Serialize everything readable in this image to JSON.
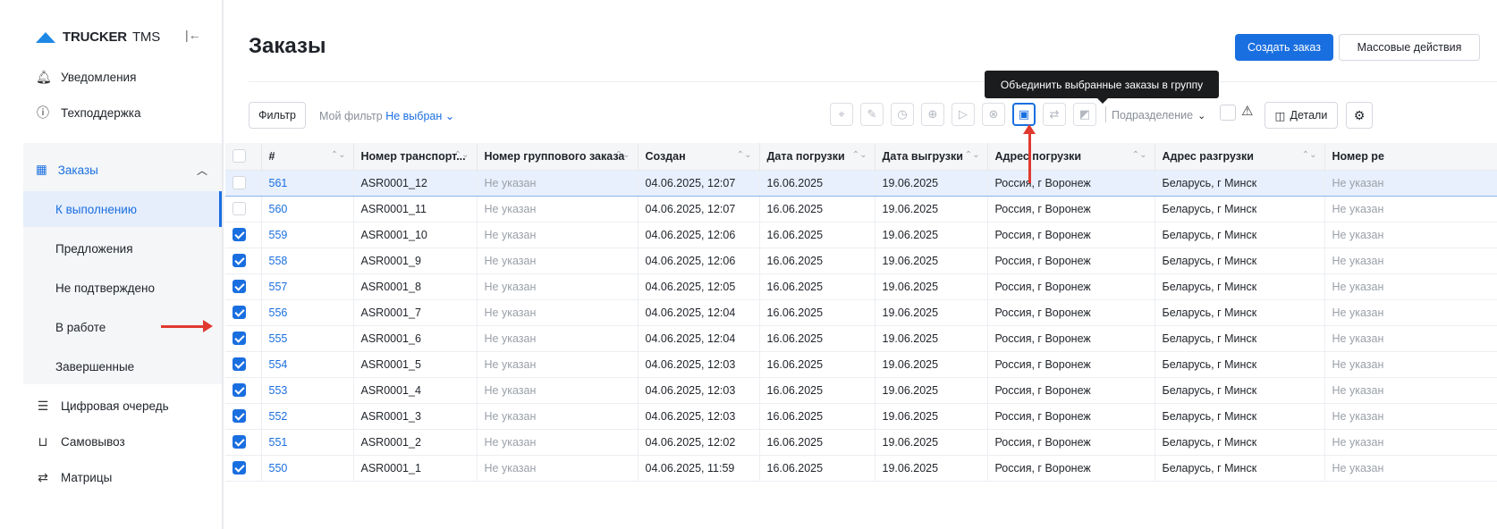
{
  "sidebar": {
    "logo_bold": "TRUCKER",
    "logo_light": "TMS",
    "top_items": [
      {
        "label": "Уведомления"
      },
      {
        "label": "Техподдержка"
      }
    ],
    "orders_group": {
      "label": "Заказы",
      "sub_items": [
        {
          "label": "К выполнению"
        },
        {
          "label": "Предложения"
        },
        {
          "label": "Не подтверждено"
        },
        {
          "label": "В работе"
        },
        {
          "label": "Завершенные"
        }
      ]
    },
    "bottom_items": [
      {
        "label": "Цифровая очередь"
      },
      {
        "label": "Самовывоз"
      },
      {
        "label": "Матрицы"
      }
    ]
  },
  "header": {
    "title": "Заказы",
    "create_label": "Создать заказ",
    "bulk_label": "Массовые действия"
  },
  "tooltip": "Объединить выбранные заказы в группу",
  "toolbar": {
    "filter_label": "Фильтр",
    "my_filter_label": "Мой фильтр",
    "my_filter_value": "Не выбран",
    "division_label": "Подразделение",
    "details_label": "Детали"
  },
  "table": {
    "columns": [
      "#",
      "Номер транспорт...",
      "Номер группового заказа",
      "Создан",
      "Дата погрузки",
      "Дата выгрузки",
      "Адрес погрузки",
      "Адрес разгрузки",
      "Номер ре"
    ],
    "rows": [
      {
        "num": "561",
        "transport": "ASR0001_12",
        "group": "Не указан",
        "created": "04.06.2025, 12:07",
        "load": "16.06.2025",
        "unload": "19.06.2025",
        "from": "Россия, г Воронеж",
        "to": "Беларусь, г Минск",
        "reg": "Не указан"
      },
      {
        "num": "560",
        "transport": "ASR0001_11",
        "group": "Не указан",
        "created": "04.06.2025, 12:07",
        "load": "16.06.2025",
        "unload": "19.06.2025",
        "from": "Россия, г Воронеж",
        "to": "Беларусь, г Минск",
        "reg": "Не указан"
      },
      {
        "num": "559",
        "transport": "ASR0001_10",
        "group": "Не указан",
        "created": "04.06.2025, 12:06",
        "load": "16.06.2025",
        "unload": "19.06.2025",
        "from": "Россия, г Воронеж",
        "to": "Беларусь, г Минск",
        "reg": "Не указан"
      },
      {
        "num": "558",
        "transport": "ASR0001_9",
        "group": "Не указан",
        "created": "04.06.2025, 12:06",
        "load": "16.06.2025",
        "unload": "19.06.2025",
        "from": "Россия, г Воронеж",
        "to": "Беларусь, г Минск",
        "reg": "Не указан"
      },
      {
        "num": "557",
        "transport": "ASR0001_8",
        "group": "Не указан",
        "created": "04.06.2025, 12:05",
        "load": "16.06.2025",
        "unload": "19.06.2025",
        "from": "Россия, г Воронеж",
        "to": "Беларусь, г Минск",
        "reg": "Не указан"
      },
      {
        "num": "556",
        "transport": "ASR0001_7",
        "group": "Не указан",
        "created": "04.06.2025, 12:04",
        "load": "16.06.2025",
        "unload": "19.06.2025",
        "from": "Россия, г Воронеж",
        "to": "Беларусь, г Минск",
        "reg": "Не указан"
      },
      {
        "num": "555",
        "transport": "ASR0001_6",
        "group": "Не указан",
        "created": "04.06.2025, 12:04",
        "load": "16.06.2025",
        "unload": "19.06.2025",
        "from": "Россия, г Воронеж",
        "to": "Беларусь, г Минск",
        "reg": "Не указан"
      },
      {
        "num": "554",
        "transport": "ASR0001_5",
        "group": "Не указан",
        "created": "04.06.2025, 12:03",
        "load": "16.06.2025",
        "unload": "19.06.2025",
        "from": "Россия, г Воронеж",
        "to": "Беларусь, г Минск",
        "reg": "Не указан"
      },
      {
        "num": "553",
        "transport": "ASR0001_4",
        "group": "Не указан",
        "created": "04.06.2025, 12:03",
        "load": "16.06.2025",
        "unload": "19.06.2025",
        "from": "Россия, г Воронеж",
        "to": "Беларусь, г Минск",
        "reg": "Не указан"
      },
      {
        "num": "552",
        "transport": "ASR0001_3",
        "group": "Не указан",
        "created": "04.06.2025, 12:03",
        "load": "16.06.2025",
        "unload": "19.06.2025",
        "from": "Россия, г Воронеж",
        "to": "Беларусь, г Минск",
        "reg": "Не указан"
      },
      {
        "num": "551",
        "transport": "ASR0001_2",
        "group": "Не указан",
        "created": "04.06.2025, 12:02",
        "load": "16.06.2025",
        "unload": "19.06.2025",
        "from": "Россия, г Воронеж",
        "to": "Беларусь, г Минск",
        "reg": "Не указан"
      },
      {
        "num": "550",
        "transport": "ASR0001_1",
        "group": "Не указан",
        "created": "04.06.2025, 11:59",
        "load": "16.06.2025",
        "unload": "19.06.2025",
        "from": "Россия, г Воронеж",
        "to": "Беларусь, г Минск",
        "reg": "Не указан"
      }
    ]
  },
  "colors": {
    "accent": "#1a6fe0",
    "annotation": "#e03a2f",
    "tooltip_bg": "#1b1c1e"
  },
  "icons": [
    "bell-icon",
    "help-circle-icon",
    "calendar-icon",
    "list-icon",
    "pickup-icon",
    "swap-icon",
    "gear-icon",
    "warning-icon",
    "columns-icon"
  ]
}
